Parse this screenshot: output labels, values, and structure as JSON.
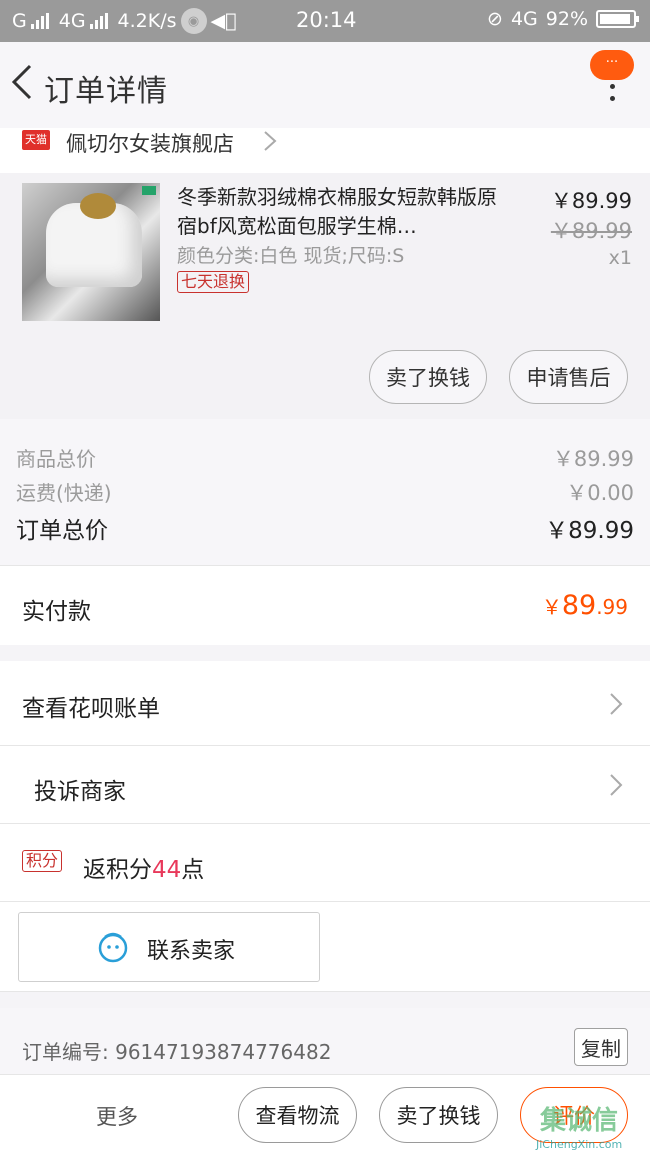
{
  "status_bar": {
    "carrier": "G",
    "network": "4G",
    "speed": "4.2K/s",
    "time": "20:14",
    "network2": "4G",
    "battery": "92%"
  },
  "header": {
    "title": "订单详情",
    "menu_badge": "···"
  },
  "store": {
    "badge": "天猫",
    "name": "佩切尔女装旗舰店"
  },
  "item": {
    "title": "冬季新款羽绒棉衣棉服女短款韩版原宿bf风宽松面包服学生棉…",
    "sku": "颜色分类:白色 现货;尺码:S",
    "tag": "七天退换",
    "price": "￥89.99",
    "original_price": "￥89.99",
    "quantity": "x1",
    "sell_button": "卖了换钱",
    "aftersale_button": "申请售后"
  },
  "summary": {
    "goods_label": "商品总价",
    "goods_value": "￥89.99",
    "shipping_label": "运费(快递)",
    "shipping_value": "￥0.00",
    "total_label": "订单总价",
    "total_value": "￥89.99"
  },
  "payment": {
    "label": "实付款",
    "currency": "￥",
    "integer": "89",
    "decimal": ".99"
  },
  "actions": {
    "huabei": "查看花呗账单",
    "complain": "投诉商家",
    "points_badge": "积分",
    "points_prefix": "返积分",
    "points_value": "44",
    "points_suffix": "点",
    "contact_seller": "联系卖家"
  },
  "order": {
    "number_label": "订单编号: ",
    "number_value": "96147193874776482",
    "copy_button": "复制"
  },
  "bottom_bar": {
    "more": "更多",
    "logistics_button": "查看物流",
    "sell_button": "卖了换钱",
    "review_button": "评价"
  },
  "watermark": {
    "text": "集诚信",
    "url": "JiChengXin.com"
  },
  "colors": {
    "accent": "#ff5000",
    "tmall_red": "#e0302b",
    "status_bar": "#9a9a9a"
  }
}
